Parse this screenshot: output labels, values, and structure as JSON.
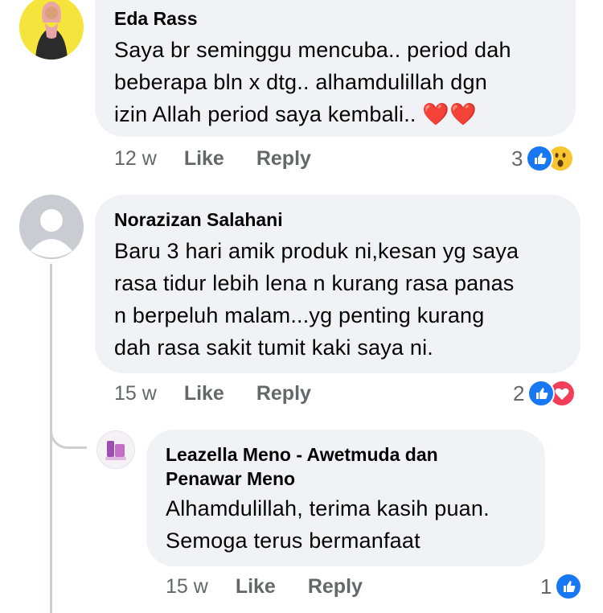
{
  "comments": [
    {
      "author": "Eda Rass",
      "lines": [
        "Saya br seminggu mencuba.. period dah",
        "beberapa bln x dtg.. alhamdulillah dgn",
        "izin Allah period saya kembali.."
      ],
      "emoji": "❤️❤️",
      "time": "12 w",
      "like_label": "Like",
      "reply_label": "Reply",
      "reaction_count": "3",
      "reactions": [
        "like-icon",
        "wow-icon"
      ]
    },
    {
      "author": "Norazizan Salahani",
      "lines": [
        "Baru 3 hari amik produk ni,kesan yg saya",
        "rasa tidur lebih lena n kurang rasa panas",
        "n berpeluh malam...yg penting kurang",
        "dah rasa sakit tumit kaki saya ni."
      ],
      "time": "15 w",
      "like_label": "Like",
      "reply_label": "Reply",
      "reaction_count": "2",
      "reactions": [
        "like-icon",
        "love-icon"
      ]
    },
    {
      "author_line1": "Leazella Meno - Awetmuda dan",
      "author_line2": "Penawar Meno",
      "lines": [
        "Alhamdulillah, terima kasih puan.",
        "Semoga terus bermanfaat"
      ],
      "time": "15 w",
      "like_label": "Like",
      "reply_label": "Reply",
      "reaction_count": "1",
      "reactions": [
        "like-icon"
      ]
    }
  ],
  "colors": {
    "bubble": "#f0f2f5",
    "meta": "#65676b",
    "like_blue": "#1877f2",
    "love_red": "#f33e58",
    "avatar_yellow": "#f5e43b",
    "avatar_grey": "#c9ccd1"
  }
}
